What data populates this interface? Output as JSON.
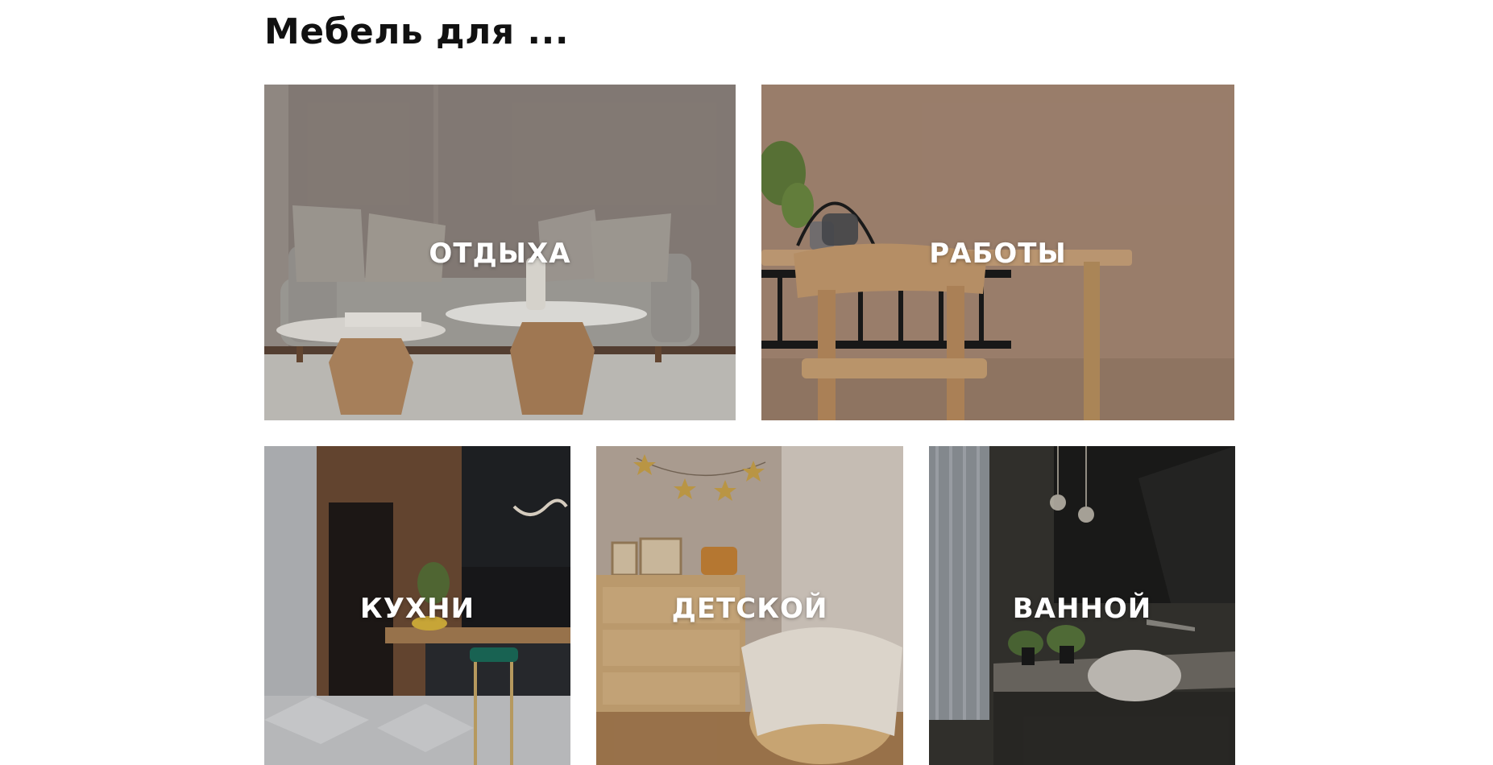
{
  "section": {
    "title": "Мебель для ..."
  },
  "categories": [
    {
      "label": "ОТДЫХА",
      "scene": "living-room-sofa-coffee-tables"
    },
    {
      "label": "РАБОТЫ",
      "scene": "wooden-desk-chair-plant"
    },
    {
      "label": "КУХНИ",
      "scene": "kitchen-island-bar-stool"
    },
    {
      "label": "ДЕТСКОЙ",
      "scene": "nursery-dresser-crib-garland"
    },
    {
      "label": "ВАННОЙ",
      "scene": "dark-bathroom-vessel-sink-mirror"
    }
  ],
  "colors": {
    "title_text": "#111111",
    "label_text": "#ffffff",
    "background": "#ffffff"
  }
}
